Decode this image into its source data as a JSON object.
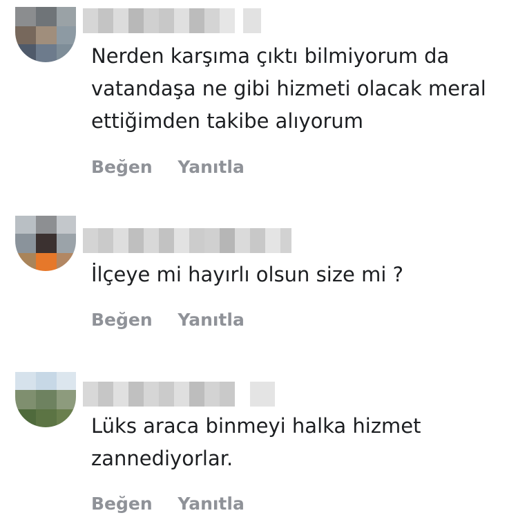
{
  "comments": [
    {
      "lines": [
        "Nerden karşıma çıktı bilmiyorum da",
        "vatandaşa ne gibi hizmeti olacak meral",
        "ettiğimden takibe alıyorum"
      ],
      "like_label": "Beğen",
      "reply_label": "Yanıtla"
    },
    {
      "lines": [
        "İlçeye mi hayırlı olsun size mi ?"
      ],
      "like_label": "Beğen",
      "reply_label": "Yanıtla"
    },
    {
      "lines": [
        "Lüks araca binmeyi halka hizmet",
        "zannediyorlar."
      ],
      "like_label": "Beğen",
      "reply_label": "Yanıtla"
    }
  ],
  "colors": {
    "text": "#1c1e21",
    "secondary": "#8f9298",
    "background": "#ffffff"
  }
}
